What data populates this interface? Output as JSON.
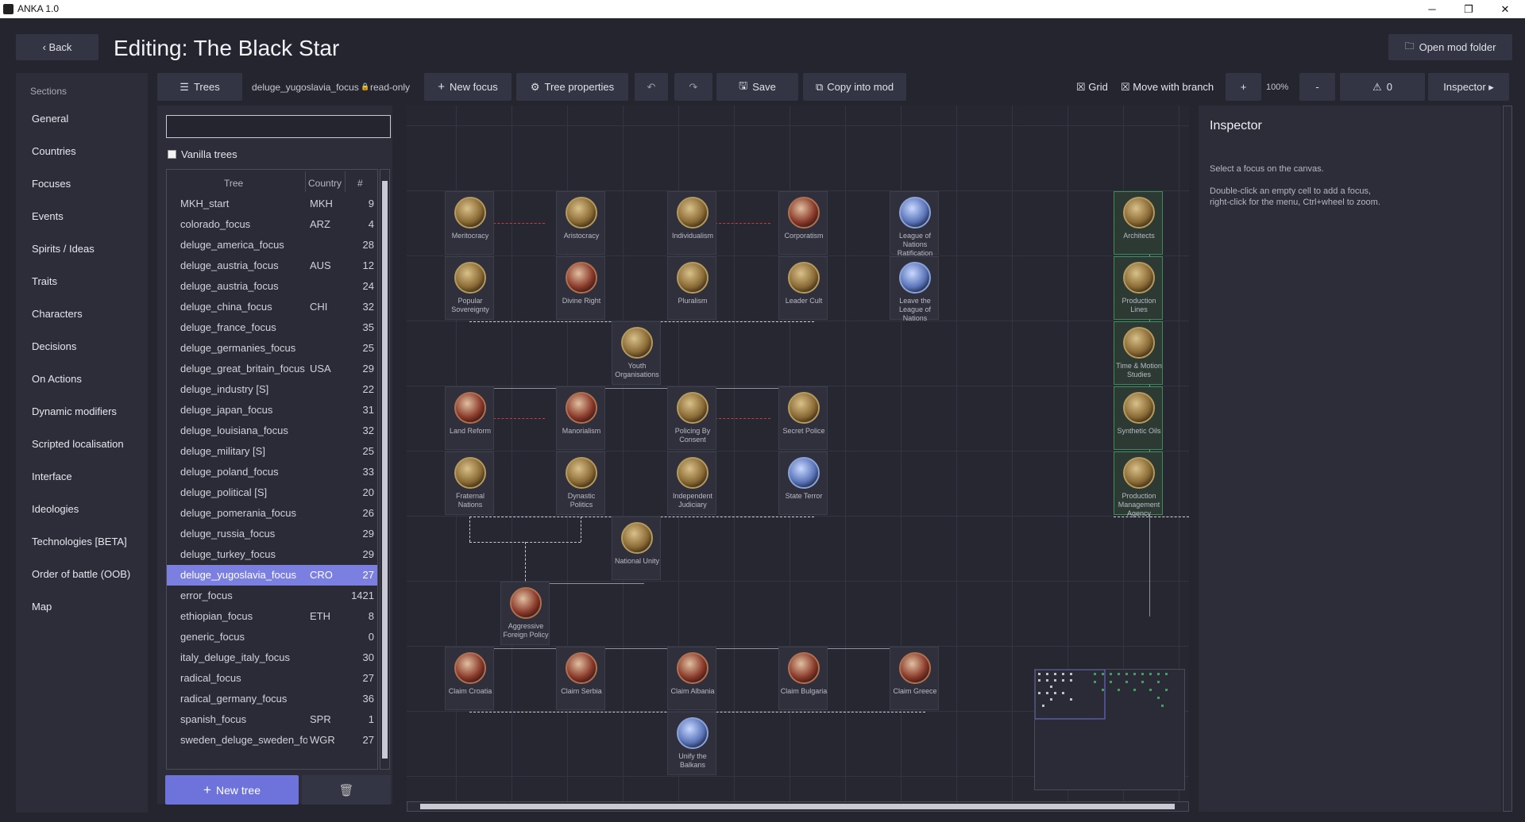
{
  "window": {
    "title": "ANKA 1.0",
    "minimize": "─",
    "maximize": "❐",
    "close": "✕"
  },
  "header": {
    "back": "‹ Back",
    "title": "Editing: The Black Star",
    "open_mod": "Open mod folder"
  },
  "sidebar": {
    "heading": "Sections",
    "items": [
      "General",
      "Countries",
      "Focuses",
      "Events",
      "Spirits / Ideas",
      "Traits",
      "Characters",
      "Decisions",
      "On Actions",
      "Dynamic modifiers",
      "Scripted localisation",
      "Interface",
      "Ideologies",
      "Technologies [BETA]",
      "Order of battle (OOB)",
      "Map"
    ]
  },
  "toolbar": {
    "trees": "Trees",
    "file": "deluge_yugoslavia_focus",
    "readonly": "read-only",
    "new_focus": "New focus",
    "tree_properties": "Tree properties",
    "undo": "↶",
    "redo": "↷",
    "save": "Save",
    "copy_into_mod": "Copy into mod",
    "grid": "Grid",
    "move_with_branch": "Move with branch",
    "zoom_in": "+",
    "zoom": "100%",
    "zoom_out": "-",
    "warnings": "0",
    "inspector": "Inspector ▸"
  },
  "tree_panel": {
    "search_placeholder": "",
    "vanilla": "Vanilla trees",
    "col_tree": "Tree",
    "col_country": "Country",
    "col_count": "#",
    "new_tree": "New tree",
    "rows": [
      {
        "name": "MKH_start",
        "country": "MKH",
        "count": "9"
      },
      {
        "name": "colorado_focus",
        "country": "ARZ",
        "count": "4"
      },
      {
        "name": "deluge_america_focus",
        "country": "",
        "count": "28"
      },
      {
        "name": "deluge_austria_focus",
        "country": "AUS",
        "count": "12"
      },
      {
        "name": "deluge_austria_focus",
        "country": "",
        "count": "24"
      },
      {
        "name": "deluge_china_focus",
        "country": "CHI",
        "count": "32"
      },
      {
        "name": "deluge_france_focus",
        "country": "",
        "count": "35"
      },
      {
        "name": "deluge_germanies_focus",
        "country": "",
        "count": "25"
      },
      {
        "name": "deluge_great_britain_focus",
        "country": "USA",
        "count": "29"
      },
      {
        "name": "deluge_industry  [S]",
        "country": "",
        "count": "22"
      },
      {
        "name": "deluge_japan_focus",
        "country": "",
        "count": "31"
      },
      {
        "name": "deluge_louisiana_focus",
        "country": "",
        "count": "32"
      },
      {
        "name": "deluge_military  [S]",
        "country": "",
        "count": "25"
      },
      {
        "name": "deluge_poland_focus",
        "country": "",
        "count": "33"
      },
      {
        "name": "deluge_political  [S]",
        "country": "",
        "count": "20"
      },
      {
        "name": "deluge_pomerania_focus",
        "country": "",
        "count": "26"
      },
      {
        "name": "deluge_russia_focus",
        "country": "",
        "count": "29"
      },
      {
        "name": "deluge_turkey_focus",
        "country": "",
        "count": "29"
      },
      {
        "name": "deluge_yugoslavia_focus",
        "country": "CRO",
        "count": "27"
      },
      {
        "name": "error_focus",
        "country": "",
        "count": "1421"
      },
      {
        "name": "ethiopian_focus",
        "country": "ETH",
        "count": "8"
      },
      {
        "name": "generic_focus",
        "country": "",
        "count": "0"
      },
      {
        "name": "italy_deluge_italy_focus",
        "country": "",
        "count": "30"
      },
      {
        "name": "radical_focus",
        "country": "",
        "count": "27"
      },
      {
        "name": "radical_germany_focus",
        "country": "",
        "count": "36"
      },
      {
        "name": "spanish_focus",
        "country": "SPR",
        "count": "1"
      },
      {
        "name": "sweden_deluge_sweden_focus",
        "country": "WGR",
        "count": "27"
      }
    ]
  },
  "focuses": {
    "meritocracy": "Meritocracy",
    "aristocracy": "Aristocracy",
    "individualism": "Individualism",
    "corporatism": "Corporatism",
    "league_ratification": "League of Nations Ratification",
    "architects": "Architects",
    "popular_sovereignty": "Popular Sovereignty",
    "divine_right": "Divine Right",
    "pluralism": "Pluralism",
    "leader_cult": "Leader Cult",
    "leave_league": "Leave the League of Nations",
    "production_lines": "Production Lines",
    "youth_organisations": "Youth Organisations",
    "time_motion": "Time & Motion Studies",
    "land_reform": "Land Reform",
    "manorialism": "Manorialism",
    "policing_by_consent": "Policing By Consent",
    "secret_police": "Secret Police",
    "synthetic_oils": "Synthetic Oils",
    "fraternal_nations": "Fraternal Nations",
    "dynastic_politics": "Dynastic Politics",
    "independent_judiciary": "Independent Judiciary",
    "state_terror": "State Terror",
    "production_management": "Production Management Agency",
    "national_unity": "National Unity",
    "aggressive_foreign_policy": "Aggressive Foreign Policy",
    "claim_croatia": "Claim Croatia",
    "claim_serbia": "Claim Serbia",
    "claim_albania": "Claim Albania",
    "claim_bulgaria": "Claim Bulgaria",
    "claim_greece": "Claim Greece",
    "unify_balkans": "Unify the Balkans"
  },
  "inspector": {
    "title": "Inspector",
    "hint": "Select a focus on the canvas.",
    "help1": "Double-click an empty cell to add a focus,",
    "help2": "right-click for the menu, Ctrl+wheel to zoom."
  },
  "icons": {
    "back": "chevron-left-icon",
    "folder": "folder-icon",
    "list": "list-icon",
    "plus": "plus-icon",
    "gear": "gear-icon",
    "save": "save-icon",
    "copy": "copy-icon",
    "warning": "warning-icon",
    "trash": "trash-icon",
    "lock": "lock-icon"
  }
}
